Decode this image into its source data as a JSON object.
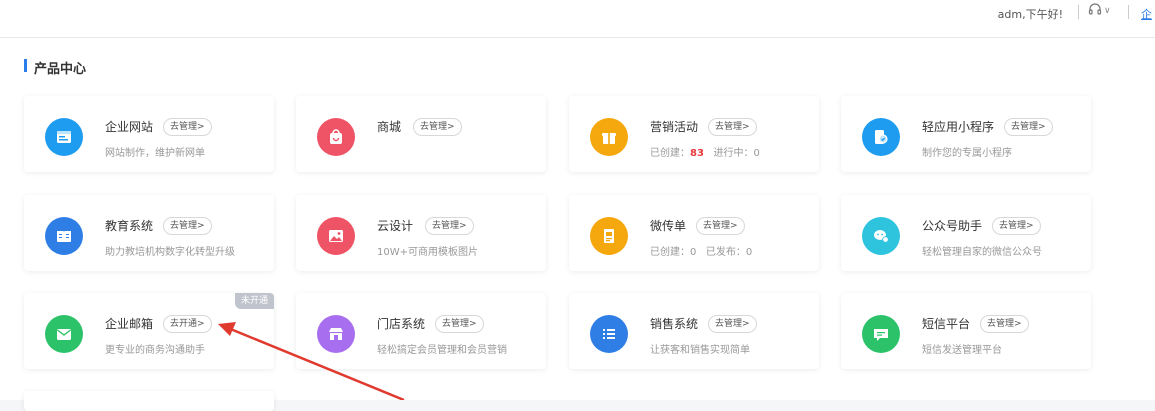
{
  "header": {
    "greeting": "adm,下午好!",
    "link_partial": "企"
  },
  "section": {
    "title": "产品中心"
  },
  "colors": {
    "accent": "#2b7de9",
    "red_value": "#e8383d",
    "arrow": "#e03a2f"
  },
  "cards": [
    {
      "name": "企业网站",
      "button": "去管理>",
      "desc": "网站制作，维护新网单",
      "icon": "website-icon",
      "color": "#1e9cf0"
    },
    {
      "name": "商城",
      "button": "去管理>",
      "desc": "",
      "icon": "shop-bag-icon",
      "color": "#ef5366"
    },
    {
      "name": "营销活动",
      "button": "去管理>",
      "desc_prefix": "已创建：",
      "desc_value": "83",
      "desc_suffix": "进行中：0",
      "icon": "gift-icon",
      "color": "#f5a80d"
    },
    {
      "name": "轻应用小程序",
      "button": "去管理>",
      "desc": "制作您的专属小程序",
      "icon": "miniprogram-icon",
      "color": "#1e9cf0"
    },
    {
      "name": "教育系统",
      "button": "去管理>",
      "desc": "助力教培机构数字化转型升级",
      "icon": "book-icon",
      "color": "#2f7ee5"
    },
    {
      "name": "云设计",
      "button": "去管理>",
      "desc": "10W+可商用模板图片",
      "icon": "image-icon",
      "color": "#ef5366"
    },
    {
      "name": "微传单",
      "button": "去管理>",
      "desc_prefix": "已创建：0",
      "desc_suffix": "已发布：0",
      "icon": "flyer-icon",
      "color": "#f5a80d"
    },
    {
      "name": "公众号助手",
      "button": "去管理>",
      "desc": "轻松管理自家的微信公众号",
      "icon": "wechat-icon",
      "color": "#2ec4de"
    },
    {
      "name": "企业邮箱",
      "button": "去开通>",
      "desc": "更专业的商务沟通助手",
      "icon": "mail-icon",
      "color": "#2cc26a",
      "badge": "未开通"
    },
    {
      "name": "门店系统",
      "button": "去管理>",
      "desc": "轻松搞定会员管理和会员营销",
      "icon": "store-icon",
      "color": "#a86ef0"
    },
    {
      "name": "销售系统",
      "button": "去管理>",
      "desc": "让获客和销售实现简单",
      "icon": "list-icon",
      "color": "#2f7ee5"
    },
    {
      "name": "短信平台",
      "button": "去管理>",
      "desc": "短信发送管理平台",
      "icon": "message-icon",
      "color": "#2cc26a"
    }
  ]
}
